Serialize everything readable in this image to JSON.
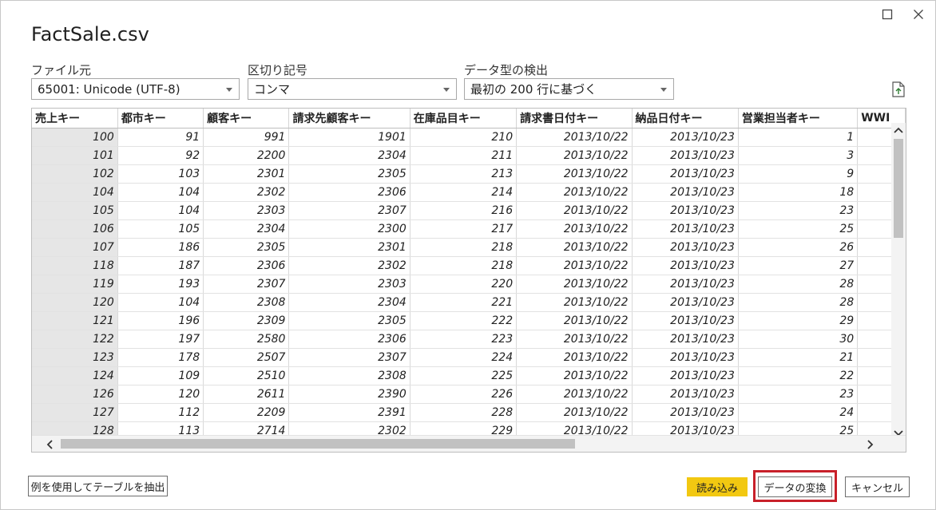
{
  "dialog": {
    "title": "FactSale.csv"
  },
  "options": {
    "file_origin": {
      "label": "ファイル元",
      "value": "65001: Unicode (UTF-8)"
    },
    "delimiter": {
      "label": "区切り記号",
      "value": "コンマ"
    },
    "data_type_detection": {
      "label": "データ型の検出",
      "value": "最初の 200 行に基づく"
    }
  },
  "table": {
    "headers": [
      "売上キー",
      "都市キー",
      "顧客キー",
      "請求先顧客キー",
      "在庫品目キー",
      "請求書日付キー",
      "納品日付キー",
      "営業担当者キー",
      "WWI"
    ],
    "rows": [
      [
        "100",
        "91",
        "991",
        "1901",
        "210",
        "2013/10/22",
        "2013/10/23",
        "1"
      ],
      [
        "101",
        "92",
        "2200",
        "2304",
        "211",
        "2013/10/22",
        "2013/10/23",
        "3"
      ],
      [
        "102",
        "103",
        "2301",
        "2305",
        "213",
        "2013/10/22",
        "2013/10/23",
        "9"
      ],
      [
        "104",
        "104",
        "2302",
        "2306",
        "214",
        "2013/10/22",
        "2013/10/23",
        "18"
      ],
      [
        "105",
        "104",
        "2303",
        "2307",
        "216",
        "2013/10/22",
        "2013/10/23",
        "23"
      ],
      [
        "106",
        "105",
        "2304",
        "2300",
        "217",
        "2013/10/22",
        "2013/10/23",
        "25"
      ],
      [
        "107",
        "186",
        "2305",
        "2301",
        "218",
        "2013/10/22",
        "2013/10/23",
        "26"
      ],
      [
        "118",
        "187",
        "2306",
        "2302",
        "218",
        "2013/10/22",
        "2013/10/23",
        "27"
      ],
      [
        "119",
        "193",
        "2307",
        "2303",
        "220",
        "2013/10/22",
        "2013/10/23",
        "28"
      ],
      [
        "120",
        "104",
        "2308",
        "2304",
        "221",
        "2013/10/22",
        "2013/10/23",
        "28"
      ],
      [
        "121",
        "196",
        "2309",
        "2305",
        "222",
        "2013/10/22",
        "2013/10/23",
        "29"
      ],
      [
        "122",
        "197",
        "2580",
        "2306",
        "223",
        "2013/10/22",
        "2013/10/23",
        "30"
      ],
      [
        "123",
        "178",
        "2507",
        "2307",
        "224",
        "2013/10/22",
        "2013/10/23",
        "21"
      ],
      [
        "124",
        "109",
        "2510",
        "2308",
        "225",
        "2013/10/22",
        "2013/10/23",
        "22"
      ],
      [
        "126",
        "120",
        "2611",
        "2390",
        "226",
        "2013/10/22",
        "2013/10/23",
        "23"
      ],
      [
        "127",
        "112",
        "2209",
        "2391",
        "228",
        "2013/10/22",
        "2013/10/23",
        "24"
      ],
      [
        "128",
        "113",
        "2714",
        "2302",
        "229",
        "2013/10/22",
        "2013/10/23",
        "25"
      ]
    ]
  },
  "buttons": {
    "extract": "例を使用してテーブルを抽出",
    "load": "読み込み",
    "transform": "データの変換",
    "cancel": "キャンセル"
  },
  "colors": {
    "load_button": "#f2c811",
    "highlight_border": "#c8202a",
    "row_key_bg": "#e6e6e6"
  },
  "icons": [
    "maximize-icon",
    "close-icon",
    "export-icon",
    "scroll-up-icon",
    "scroll-down-icon",
    "scroll-left-icon",
    "scroll-right-icon",
    "dropdown-arrow-icon"
  ]
}
